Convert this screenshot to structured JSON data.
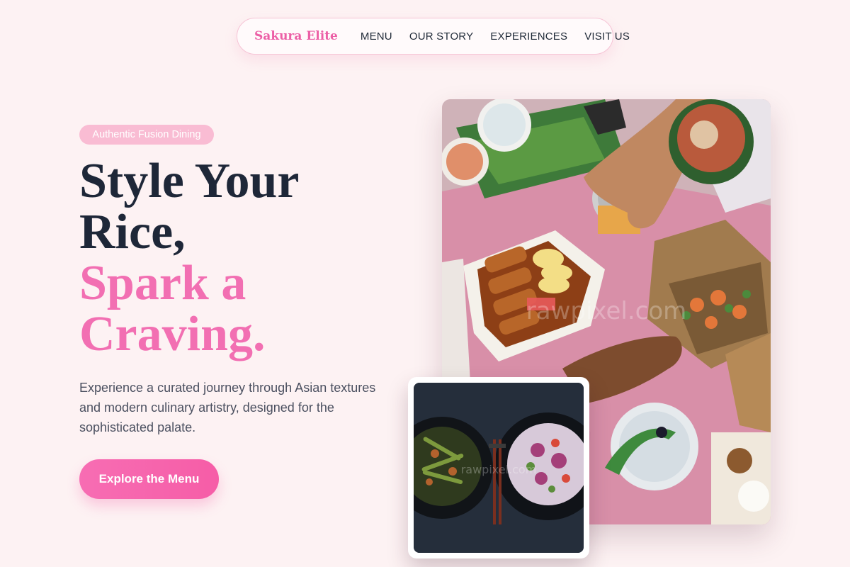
{
  "nav": {
    "brand": "Sakura Elite",
    "links": [
      {
        "label": "MENU"
      },
      {
        "label": "OUR STORY"
      },
      {
        "label": "EXPERIENCES"
      },
      {
        "label": "VISIT US"
      }
    ]
  },
  "hero": {
    "badge": "Authentic Fusion Dining",
    "headline_dark": [
      "Style Your",
      "Rice,"
    ],
    "headline_pink": [
      "Spark a",
      "Craving."
    ],
    "description": "Experience a curated journey through Asian textures and modern culinary artistry, designed for the sophisticated palate.",
    "cta_label": "Explore the Menu"
  },
  "images": {
    "main_photo": "overhead food spread on pink table with hands holding a can",
    "inset_photo": "two dark bowls of salad with chopsticks on dark surface",
    "watermark": "rawpixel.com"
  },
  "colors": {
    "accent": "#f26fb2",
    "background": "#fdf2f3",
    "heading": "#1e2738",
    "badge": "#f9bcd3"
  }
}
